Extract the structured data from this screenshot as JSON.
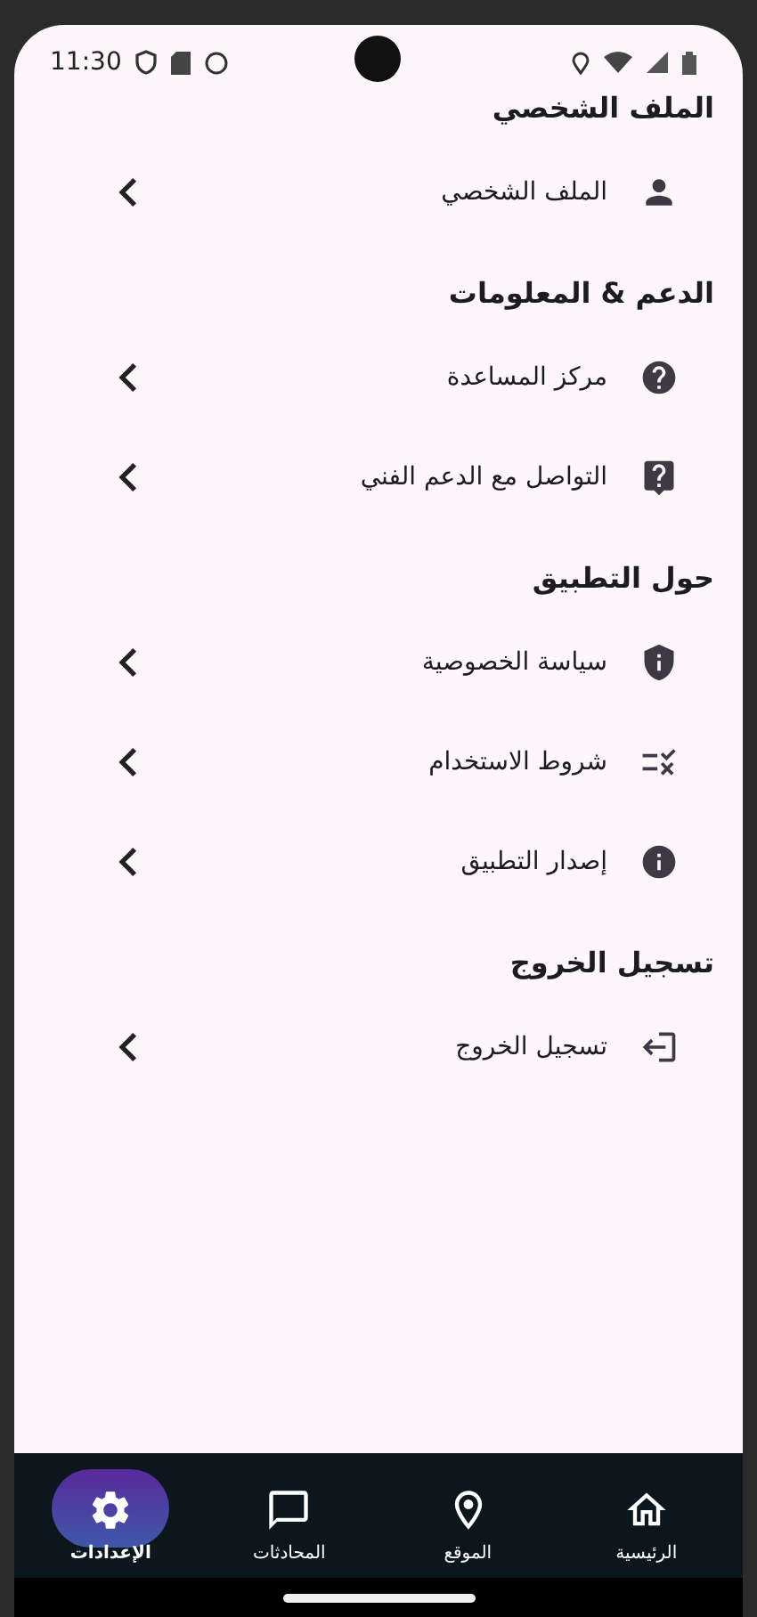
{
  "status_bar": {
    "time": "11:30"
  },
  "sections": [
    {
      "title": "الملف الشخصي",
      "items": [
        {
          "label": "الملف الشخصي",
          "kind": "profile"
        }
      ]
    },
    {
      "title": "الدعم & المعلومات",
      "items": [
        {
          "label": "مركز المساعدة",
          "kind": "help"
        },
        {
          "label": "التواصل مع الدعم الفني",
          "kind": "support"
        }
      ]
    },
    {
      "title": "حول التطبيق",
      "items": [
        {
          "label": "سياسة الخصوصية",
          "kind": "privacy"
        },
        {
          "label": "شروط الاستخدام",
          "kind": "terms"
        },
        {
          "label": "إصدار التطبيق",
          "kind": "version"
        }
      ]
    },
    {
      "title": "تسجيل الخروج",
      "items": [
        {
          "label": "تسجيل الخروج",
          "kind": "logout"
        }
      ]
    }
  ],
  "nav": [
    {
      "label": "الرئيسية",
      "kind": "home",
      "selected": false
    },
    {
      "label": "الموقع",
      "kind": "location",
      "selected": false
    },
    {
      "label": "المحادثات",
      "kind": "chat",
      "selected": false
    },
    {
      "label": "الإعدادات",
      "kind": "settings",
      "selected": true
    }
  ]
}
